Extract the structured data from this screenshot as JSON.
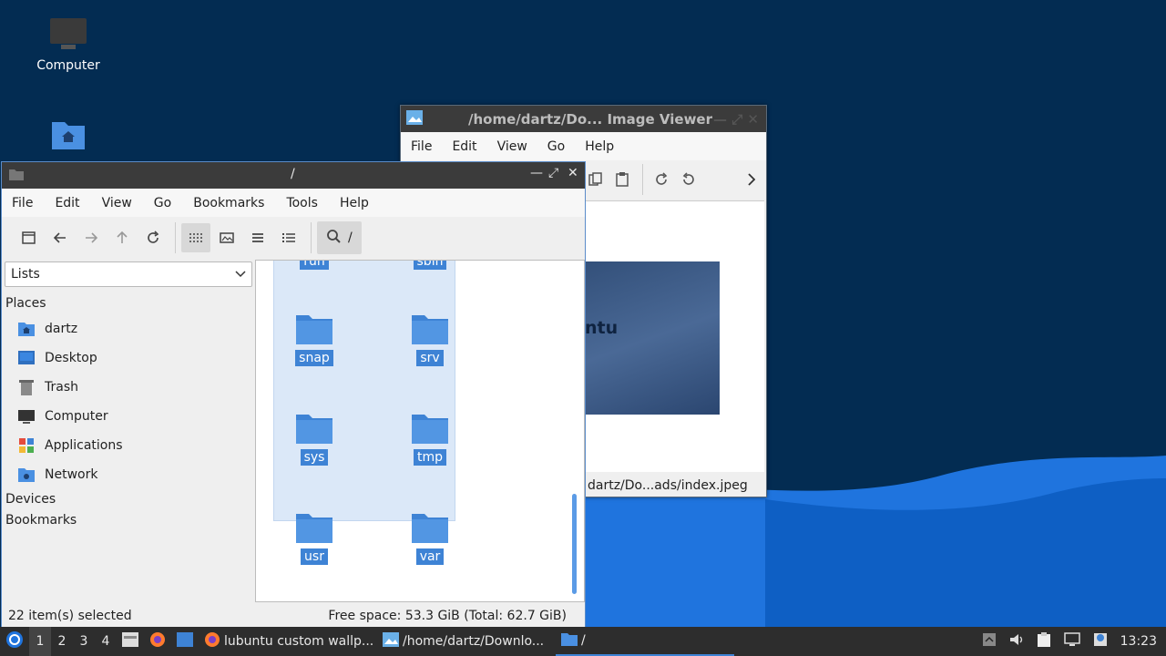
{
  "desktop": {
    "icons": [
      {
        "label": "Computer",
        "icon": "computer-icon"
      },
      {
        "label": "",
        "icon": "home-folder-icon"
      }
    ]
  },
  "image_viewer": {
    "title": "/home/dartz/Do... Image Viewer",
    "menu": [
      "File",
      "Edit",
      "View",
      "Go",
      "Help"
    ],
    "status_path": "dartz/Do...ads/index.jpeg",
    "image_caption": "ntu"
  },
  "file_manager": {
    "title": "/",
    "menu": [
      "File",
      "Edit",
      "View",
      "Go",
      "Bookmarks",
      "Tools",
      "Help"
    ],
    "path_text": "/",
    "side_combo": "Lists",
    "places_header": "Places",
    "places": [
      {
        "label": "dartz",
        "icon": "home-folder-icon"
      },
      {
        "label": "Desktop",
        "icon": "desktop-icon"
      },
      {
        "label": "Trash",
        "icon": "trash-icon"
      },
      {
        "label": "Computer",
        "icon": "computer-icon"
      },
      {
        "label": "Applications",
        "icon": "applications-icon"
      },
      {
        "label": "Network",
        "icon": "network-icon"
      }
    ],
    "devices_header": "Devices",
    "bookmarks_header": "Bookmarks",
    "folders": [
      "run",
      "sbin",
      "snap",
      "srv",
      "sys",
      "tmp",
      "usr",
      "var"
    ],
    "status_left": "22 item(s) selected",
    "status_right": "Free space: 53.3 GiB (Total: 62.7 GiB)"
  },
  "taskbar": {
    "workspaces": [
      "1",
      "2",
      "3",
      "4"
    ],
    "tasks": [
      {
        "label": "lubuntu custom wallp...",
        "icon": "firefox-icon"
      },
      {
        "label": "/home/dartz/Downlo...",
        "icon": "image-viewer-icon"
      },
      {
        "label": "/",
        "icon": "folder-icon"
      }
    ],
    "clock": "13:23"
  },
  "colors": {
    "accent": "#3e83d5",
    "desktop": "#032c52",
    "wave": "#1b6fd6"
  }
}
